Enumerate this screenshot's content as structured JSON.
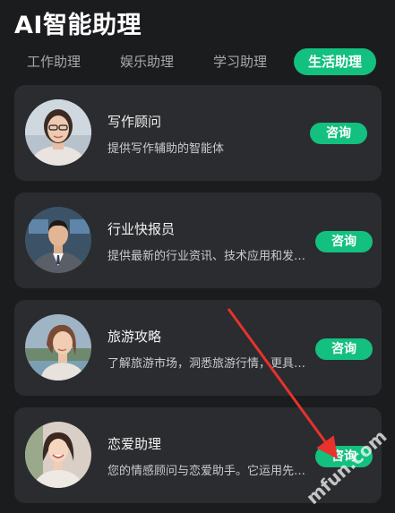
{
  "app": {
    "title": "AI智能助理"
  },
  "tabs": [
    {
      "label": "工作助理",
      "active": false
    },
    {
      "label": "娱乐助理",
      "active": false
    },
    {
      "label": "学习助理",
      "active": false
    },
    {
      "label": "生活助理",
      "active": true
    }
  ],
  "cards": [
    {
      "title": "写作顾问",
      "desc": "提供写作辅助的智能体",
      "button": "咨询",
      "avatar_icon": "portrait-glasses-woman"
    },
    {
      "title": "行业快报员",
      "desc": "提供最新的行业资讯、技术应用和发…",
      "button": "咨询",
      "avatar_icon": "portrait-suit-man"
    },
    {
      "title": "旅游攻略",
      "desc": "了解旅游市场，洞悉旅游行情，更具…",
      "button": "咨询",
      "avatar_icon": "portrait-travel-woman"
    },
    {
      "title": "恋爱助理",
      "desc": "您的情感顾问与恋爱助手。它运用先…",
      "button": "咨询",
      "avatar_icon": "portrait-smiling-woman"
    }
  ],
  "colors": {
    "background": "#1b1c1e",
    "card": "#2b2c2f",
    "accent": "#13c07f",
    "arrow": "#e8322c"
  }
}
